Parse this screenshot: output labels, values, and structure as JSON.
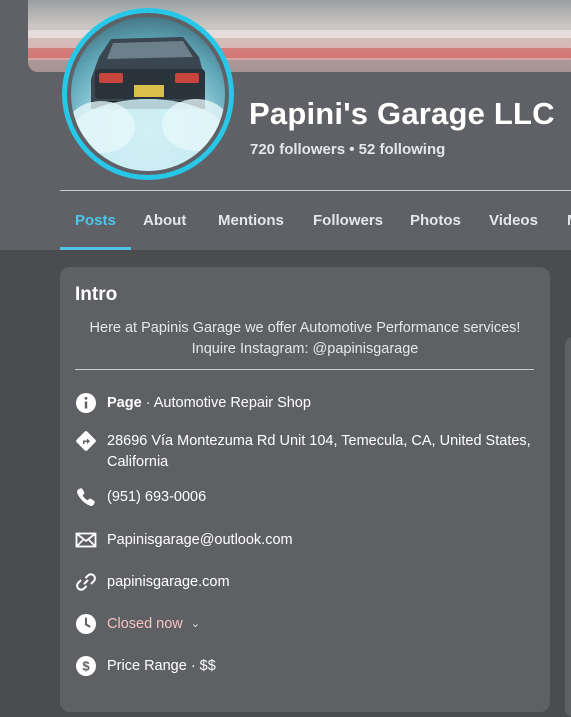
{
  "header": {
    "title": "Papini's Garage LLC",
    "followers_text": "720 followers • 52 following",
    "accent_color": "#4cc5e8"
  },
  "tabs": [
    {
      "label": "Posts",
      "active": true
    },
    {
      "label": "About"
    },
    {
      "label": "Mentions"
    },
    {
      "label": "Followers"
    },
    {
      "label": "Photos"
    },
    {
      "label": "Videos"
    },
    {
      "label": "M"
    }
  ],
  "intro": {
    "title": "Intro",
    "bio_line1": "Here at Papinis Garage we offer Automotive Performance services!",
    "bio_line2": "Inquire Instagram: @papinisgarage",
    "page_label": "Page",
    "page_category": " · Automotive Repair Shop",
    "address": "28696 Vía Montezuma Rd Unit 104, Temecula, CA, United States, California",
    "phone": "(951) 693-0006",
    "email": "Papinisgarage@outlook.com",
    "website": "papinisgarage.com",
    "hours_status": "Closed now",
    "price_range": "Price Range · $$"
  },
  "icons": {
    "info": "info-icon",
    "directions": "directions-icon",
    "phone": "phone-icon",
    "email": "email-icon",
    "link": "link-icon",
    "clock": "clock-icon",
    "price": "dollar-icon"
  }
}
